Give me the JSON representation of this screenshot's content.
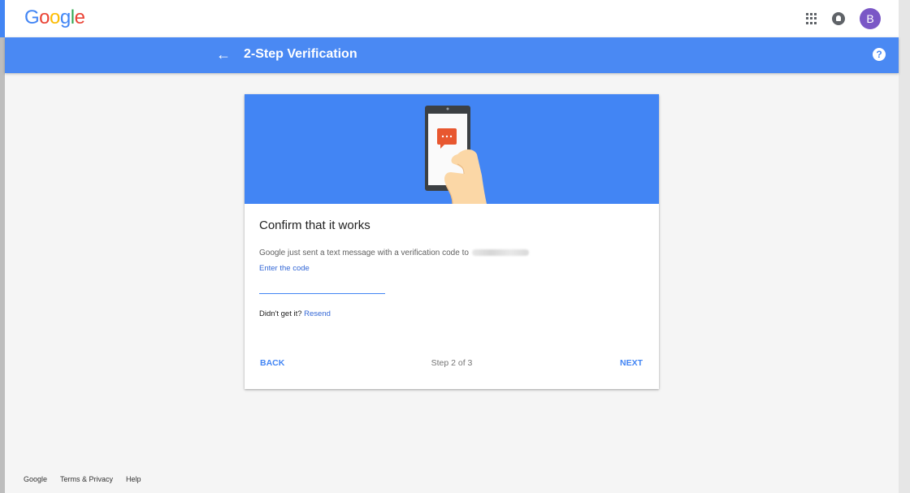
{
  "colors": {
    "primary_blue": "#4285f4",
    "header_blue": "#4a89f3",
    "link_blue": "#3367d6",
    "avatar_purple": "#7a57c6",
    "message_orange": "#e8572f"
  },
  "topbar": {
    "logo_letters": [
      {
        "char": "G",
        "color": "#4285f4"
      },
      {
        "char": "o",
        "color": "#ea4335"
      },
      {
        "char": "o",
        "color": "#fbbc05"
      },
      {
        "char": "g",
        "color": "#4285f4"
      },
      {
        "char": "l",
        "color": "#34a853"
      },
      {
        "char": "e",
        "color": "#ea4335"
      }
    ],
    "icons": [
      "apps-icon",
      "notifications-icon"
    ],
    "avatar_initial": "B"
  },
  "header": {
    "back_icon": "←",
    "title": "2-Step Verification",
    "help_icon": "?"
  },
  "card": {
    "title": "Confirm that it works",
    "description": "Google just sent a text message with a verification code to",
    "code_label": "Enter the code",
    "code_value": "",
    "resend_prefix": "Didn't get it?",
    "resend_link": "Resend",
    "back_label": "BACK",
    "step_text": "Step 2 of 3",
    "next_label": "NEXT"
  },
  "footer": {
    "links": [
      "Google",
      "Terms & Privacy",
      "Help"
    ]
  }
}
